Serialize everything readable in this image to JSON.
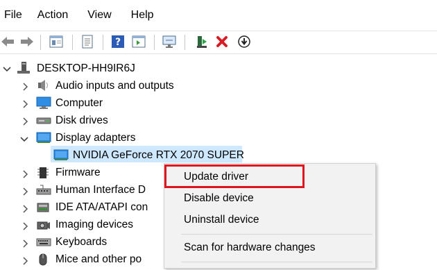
{
  "menubar": {
    "file": "File",
    "action": "Action",
    "view": "View",
    "help": "Help"
  },
  "toolbar": {
    "icons": [
      "back-arrow-icon",
      "forward-arrow-icon",
      "console-tree-icon",
      "properties-icon",
      "help-icon",
      "action-pane-icon",
      "monitor-icon",
      "update-driver-icon",
      "uninstall-icon",
      "disable-icon"
    ],
    "accent_red": "#d81b24"
  },
  "tree": {
    "root": "DESKTOP-HH9IR6J",
    "items": [
      "Audio inputs and outputs",
      "Computer",
      "Disk drives",
      "Display adapters",
      "NVIDIA GeForce RTX 2070 SUPER",
      "Firmware",
      "Human Interface D",
      "IDE ATA/ATAPI con",
      "Imaging devices",
      "Keyboards",
      "Mice and other po"
    ],
    "selection_color": "#cde8ff"
  },
  "context_menu": {
    "update_driver": "Update driver",
    "disable_device": "Disable device",
    "uninstall_device": "Uninstall device",
    "scan_hardware": "Scan for hardware changes",
    "highlight_color": "#e0141e"
  }
}
